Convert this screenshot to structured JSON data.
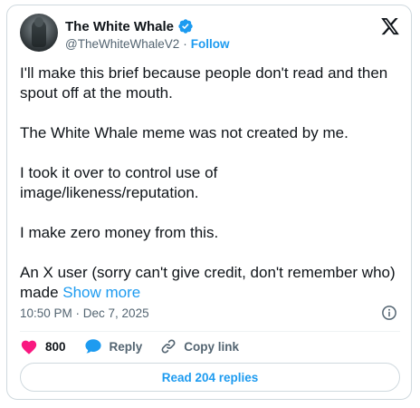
{
  "author": {
    "name": "The White Whale",
    "handle": "@TheWhiteWhaleV2",
    "separator": "·",
    "follow_label": "Follow",
    "verified": true
  },
  "post": {
    "paragraphs": [
      "I'll make this brief because people don't read and then spout off at the mouth.",
      "The White Whale meme was not created by me.",
      "I took it over to control use of image/likeness/reputation.",
      "I make zero money from this.",
      "An X user (sorry can't give credit, don't remember who) made"
    ],
    "show_more_label": "Show more",
    "timestamp": "10:50 PM · Dec 7, 2025"
  },
  "actions": {
    "like_count": "800",
    "reply_label": "Reply",
    "copy_link_label": "Copy link"
  },
  "footer": {
    "read_replies_label": "Read 204 replies"
  },
  "colors": {
    "accent": "#1d9bf0",
    "like": "#f91880",
    "text": "#0f1419",
    "muted": "#536471"
  }
}
